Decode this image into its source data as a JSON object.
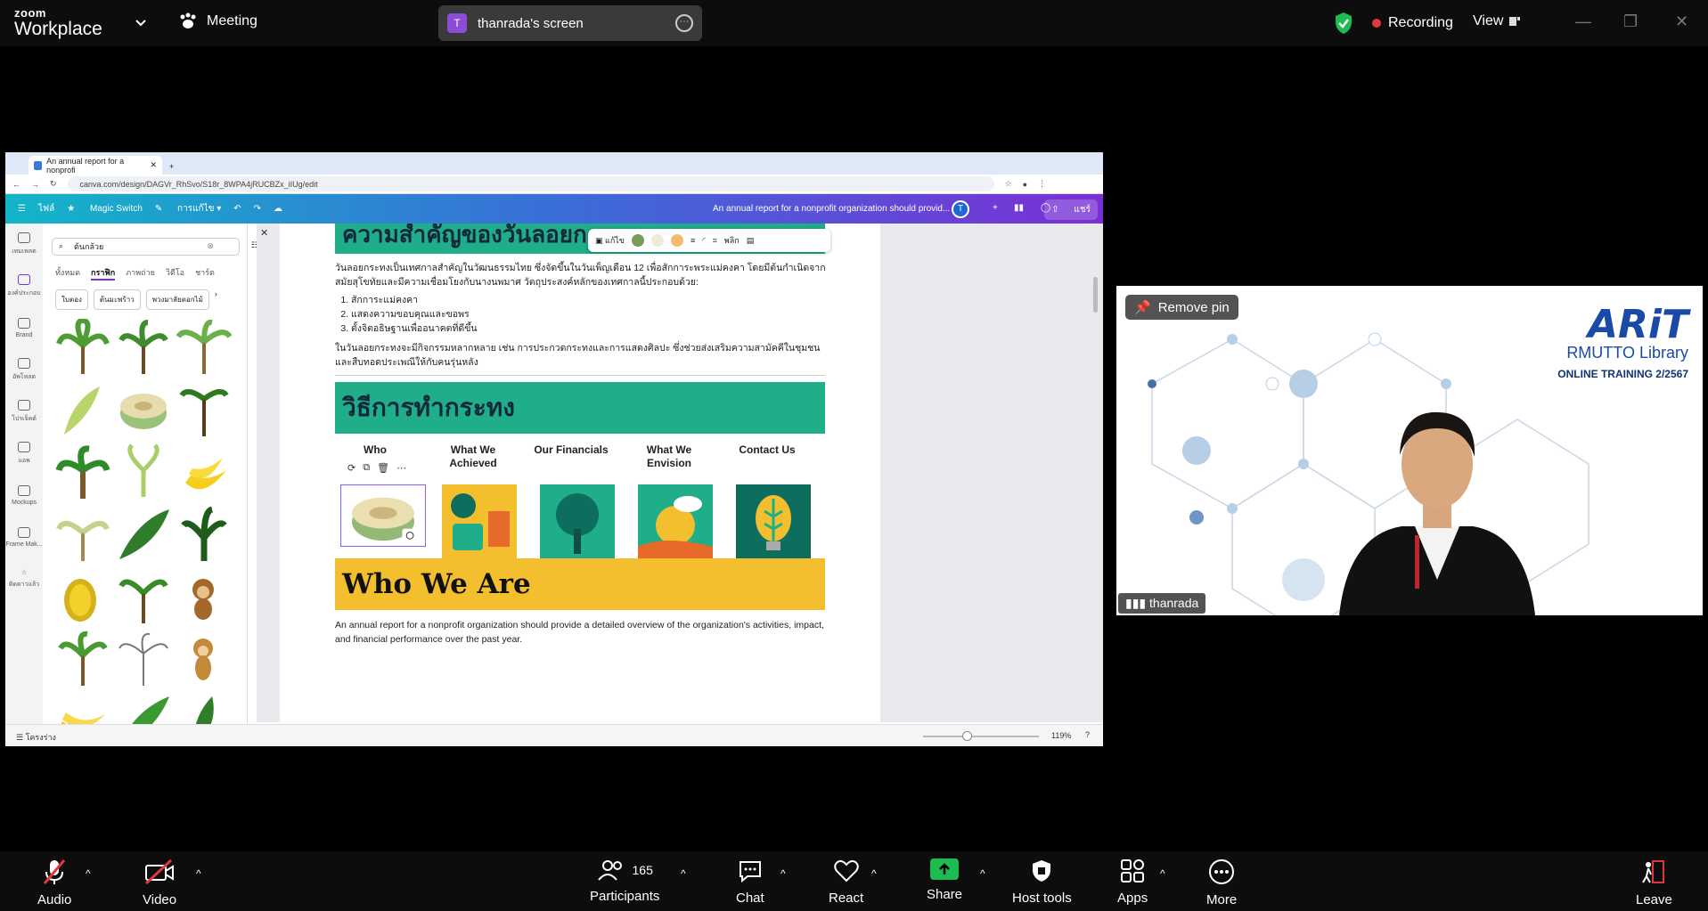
{
  "topbar": {
    "brand_top": "zoom",
    "brand_bottom": "Workplace",
    "meeting_label": "Meeting",
    "screen_avatar": "T",
    "screen_label": "thanrada's screen",
    "recording_label": "Recording",
    "view_label": "View",
    "accent_green": "#1dbb52",
    "record_red": "#e0383e"
  },
  "browser": {
    "tab_title": "An annual report for a nonprofi",
    "url": "canva.com/design/DAGVr_RhSvo/S18r_8WPA4jRUCBZx_iIUg/edit",
    "canva": {
      "menu_file": "ไฟล์",
      "magic_switch": "Magic Switch",
      "edit_label": "การแก้ไข",
      "doc_title": "An annual report for a nonprofit organization should provid...",
      "avatar": "T",
      "share": "แชร์"
    },
    "rail": [
      {
        "label": "เทมเพลต"
      },
      {
        "label": "องค์ประกอบ"
      },
      {
        "label": "Brand"
      },
      {
        "label": "อัพโหลด"
      },
      {
        "label": "โปรเจ็คต์"
      },
      {
        "label": "แอพ"
      },
      {
        "label": "Mockups"
      },
      {
        "label": "Frame Mak..."
      },
      {
        "label": "ติดดาวแล้ว"
      }
    ],
    "panel": {
      "search_value": "ต้นกล้วย",
      "filters": [
        "ทั้งหมด",
        "กราฟิก",
        "ภาพถ่าย",
        "วิดีโอ",
        "ชาร์ต"
      ],
      "chips": [
        "ใบตอง",
        "ต้นมะพร้าว",
        "พวงมาลัยดอกไม้"
      ]
    },
    "page": {
      "top_heading": "ความสำคัญของวันลอยกระทง",
      "intro": "วันลอยกระทงเป็นเทศกาลสำคัญในวัฒนธรรมไทย ซึ่งจัดขึ้นในวันเพ็ญเดือน 12 เพื่อสักการะพระแม่คงคา โดยมีต้นกำเนิดจากสมัยสุโขทัยและมีความเชื่อมโยงกับนางนพมาศ วัตถุประสงค์หลักของเทศกาลนี้ประกอบด้วย:",
      "list": [
        "สักการะแม่คงคา",
        "แสดงความขอบคุณและขอพร",
        "ตั้งจิตอธิษฐานเพื่ออนาคตที่ดีขึ้น"
      ],
      "para2": "ในวันลอยกระทงจะมีกิจกรรมหลากหลาย เช่น การประกวดกระทงและการแสดงศิลปะ ซึ่งช่วยส่งเสริมความสามัคคีในชุมชนและสืบทอดประเพณีให้กับคนรุ่นหลัง",
      "banner": "วิธีการทำกระทง",
      "columns": [
        "Who",
        "What We Achieved",
        "Our Financials",
        "What We Envision",
        "Contact Us"
      ],
      "floatbar_edit": "แก้ไข",
      "floatbar_flip": "พลิก",
      "yellow_title": "Who We Are",
      "body": "An annual report for a nonprofit organization should provide a detailed overview of the organization's activities, impact, and financial performance over the past year."
    },
    "bottom": {
      "notes_label": "โครงร่าง",
      "zoom": "119%"
    }
  },
  "video": {
    "remove_pin": "Remove pin",
    "logo_main": "ARiT",
    "logo_sub": "RMUTTO Library",
    "logo_tag": "ONLINE TRAINING 2/2567",
    "participant_name": "thanrada"
  },
  "bottombar": {
    "audio": "Audio",
    "video": "Video",
    "participants": "Participants",
    "participants_count": "165",
    "chat": "Chat",
    "react": "React",
    "share": "Share",
    "host_tools": "Host tools",
    "apps": "Apps",
    "more": "More",
    "leave": "Leave"
  }
}
